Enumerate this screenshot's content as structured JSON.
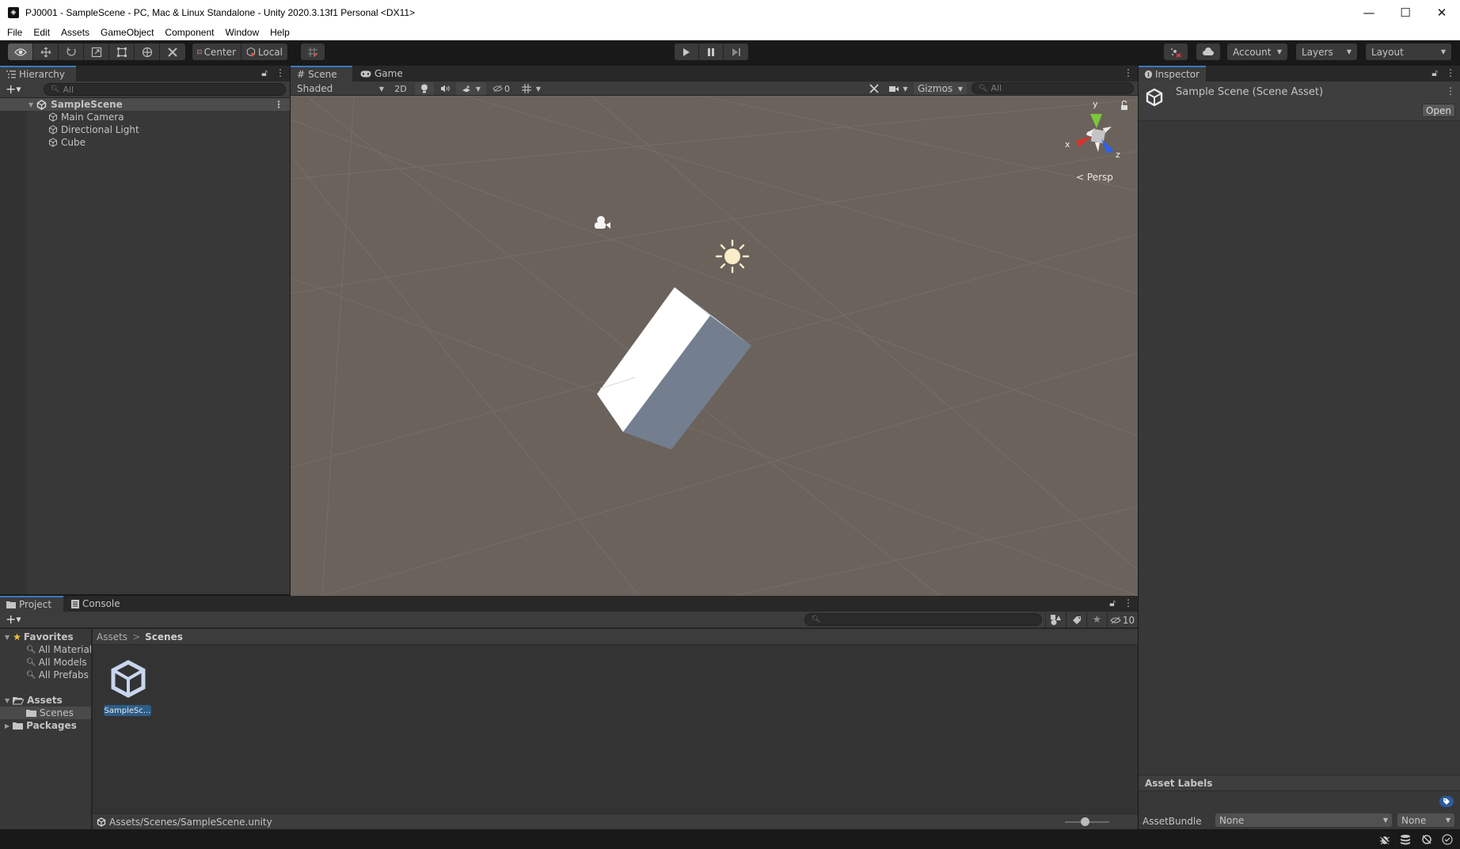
{
  "window": {
    "title": "PJ0001 - SampleScene - PC, Mac & Linux Standalone - Unity 2020.3.13f1 Personal <DX11>",
    "controls": [
      "minimize",
      "maximize",
      "close"
    ]
  },
  "menu": [
    "File",
    "Edit",
    "Assets",
    "GameObject",
    "Component",
    "Window",
    "Help"
  ],
  "toolbar": {
    "tools": [
      {
        "name": "view-tool",
        "icon": "eye-icon",
        "active": true
      },
      {
        "name": "move-tool",
        "icon": "move-icon",
        "active": false
      },
      {
        "name": "rotate-tool",
        "icon": "rotate-icon",
        "active": false
      },
      {
        "name": "scale-tool",
        "icon": "scale-icon",
        "active": false
      },
      {
        "name": "rect-tool",
        "icon": "rect-icon",
        "active": false
      },
      {
        "name": "transform-tool",
        "icon": "transform-icon",
        "active": false
      },
      {
        "name": "custom-tool",
        "icon": "tools-icon",
        "active": false
      }
    ],
    "pivot_label": "Center",
    "space_label": "Local",
    "account_label": "Account",
    "layers_label": "Layers",
    "layout_label": "Layout"
  },
  "hierarchy": {
    "tab_label": "Hierarchy",
    "search_placeholder": "All",
    "scene_name": "SampleScene",
    "items": [
      "Main Camera",
      "Directional Light",
      "Cube"
    ]
  },
  "scene": {
    "tabs": [
      {
        "label": "Scene",
        "icon": "grid-icon",
        "active": true
      },
      {
        "label": "Game",
        "icon": "gamepad-icon",
        "active": false
      }
    ],
    "draw_mode": "Shaded",
    "mode_2d_label": "2D",
    "hidden_count": "0",
    "gizmos_label": "Gizmos",
    "search_placeholder": "All",
    "projection_label": "Persp",
    "axis_labels": {
      "x": "x",
      "y": "y",
      "z": "z"
    },
    "colors": {
      "background": "#6b625c",
      "axis_x": "#d8322a",
      "axis_y": "#7cc83a",
      "axis_z": "#2e62e8"
    }
  },
  "inspector": {
    "tab_label": "Inspector",
    "asset_title": "Sample Scene (Scene Asset)",
    "open_button": "Open",
    "asset_labels_title": "Asset Labels",
    "assetbundle_label": "AssetBundle",
    "assetbundle_value": "None",
    "assetbundle_variant": "None"
  },
  "project": {
    "tabs": [
      {
        "label": "Project",
        "icon": "folder-icon",
        "active": true
      },
      {
        "label": "Console",
        "icon": "console-icon",
        "active": false
      }
    ],
    "search_value": "",
    "hidden_packages_count": "10",
    "favorites_label": "Favorites",
    "favorites": [
      "All Materials",
      "All Models",
      "All Prefabs"
    ],
    "assets_label": "Assets",
    "assets_children": [
      "Scenes"
    ],
    "packages_label": "Packages",
    "breadcrumb": [
      "Assets",
      "Scenes"
    ],
    "files": [
      {
        "name": "SampleSc...",
        "selected": true
      }
    ],
    "selected_path": "Assets/Scenes/SampleScene.unity",
    "icon_size": 0.45
  }
}
